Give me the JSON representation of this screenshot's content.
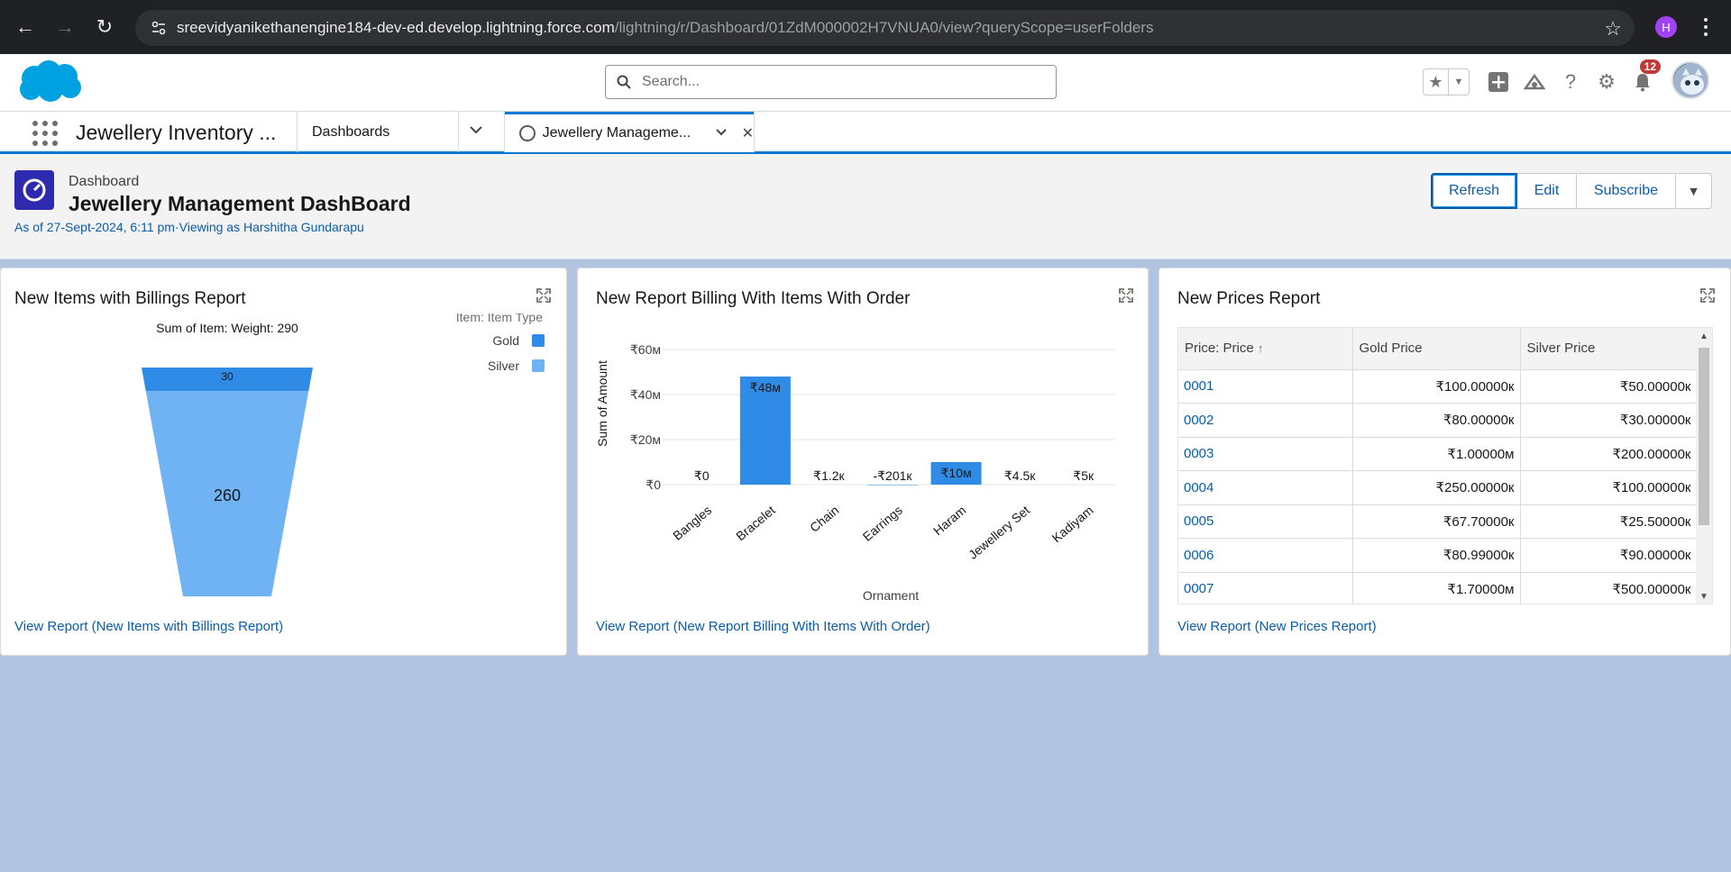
{
  "browser": {
    "url_host": "sreevidyanikethanengine184-dev-ed.develop.lightning.force.com",
    "url_path": "/lightning/r/Dashboard/01ZdM000002H7VNUA0/view?queryScope=userFolders",
    "profile_initial": "H"
  },
  "header": {
    "search_placeholder": "Search...",
    "notification_count": "12"
  },
  "nav": {
    "app_name": "Jewellery Inventory ...",
    "dashboards_label": "Dashboards",
    "active_tab_label": "Jewellery Manageme..."
  },
  "dashboard": {
    "type_label": "Dashboard",
    "title": "Jewellery Management DashBoard",
    "subtitle": "As of 27-Sept-2024, 6:11 pm·Viewing as Harshitha Gundarapu",
    "buttons": {
      "refresh": "Refresh",
      "edit": "Edit",
      "subscribe": "Subscribe"
    }
  },
  "cards": {
    "funnel": {
      "title": "New Items with Billings Report",
      "link": "View Report (New Items with Billings Report)"
    },
    "bar": {
      "title": "New Report Billing With Items With Order",
      "link": "View Report (New Report Billing With Items With Order)"
    },
    "prices": {
      "title": "New Prices Report",
      "link": "View Report (New Prices Report)",
      "columns": [
        "Price: Price",
        "Gold Price",
        "Silver Price"
      ],
      "rows": [
        [
          "0001",
          "₹100.00000к",
          "₹50.00000к"
        ],
        [
          "0002",
          "₹80.00000к",
          "₹30.00000к"
        ],
        [
          "0003",
          "₹1.00000м",
          "₹200.00000к"
        ],
        [
          "0004",
          "₹250.00000к",
          "₹100.00000к"
        ],
        [
          "0005",
          "₹67.70000к",
          "₹25.50000к"
        ],
        [
          "0006",
          "₹80.99000к",
          "₹90.00000к"
        ],
        [
          "0007",
          "₹1.70000м",
          "₹500.00000к"
        ]
      ]
    }
  },
  "chart_data": [
    {
      "type": "funnel",
      "title": "Sum of Item: Weight: 290",
      "legend_title": "Item: Item Type",
      "legend_position": "top-right",
      "series": [
        {
          "name": "Gold",
          "value": 30,
          "color": "#2f8be6"
        },
        {
          "name": "Silver",
          "value": 260,
          "color": "#6fb3f5"
        }
      ]
    },
    {
      "type": "bar",
      "xlabel": "Ornament",
      "ylabel": "Sum of Amount",
      "ylim": [
        0,
        60000000
      ],
      "yticks": [
        "₹0",
        "₹20м",
        "₹40м",
        "₹60м"
      ],
      "grid": true,
      "color": "#2f8be6",
      "categories": [
        "Bangles",
        "Bracelet",
        "Chain",
        "Earrings",
        "Haram",
        "Jewellery Set",
        "Kadiyam"
      ],
      "values": [
        0,
        48000000,
        1200,
        -201000,
        10000000,
        4500,
        5000
      ],
      "data_labels": [
        "₹0",
        "₹48м",
        "₹1.2к",
        "-₹201к",
        "₹10м",
        "₹4.5к",
        "₹5к"
      ]
    }
  ]
}
